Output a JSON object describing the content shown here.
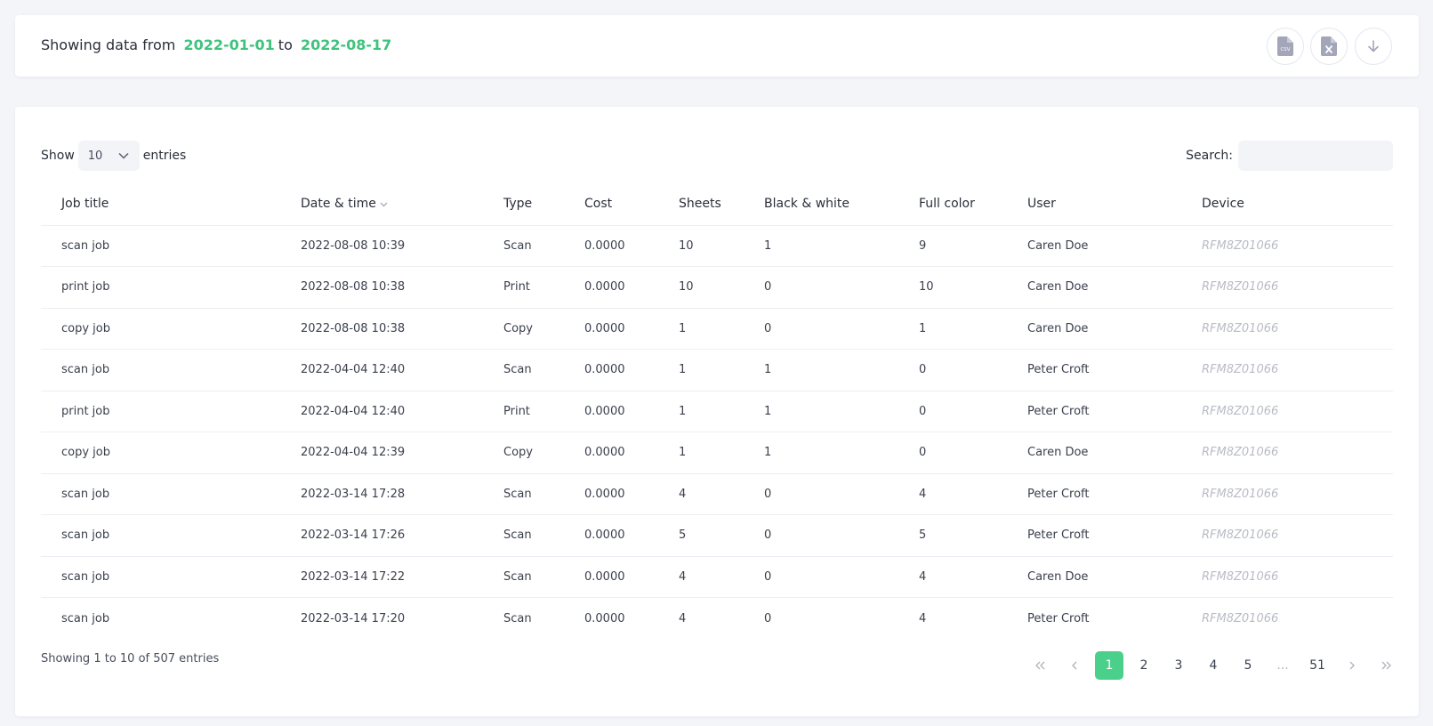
{
  "header": {
    "prefix": "Showing data from",
    "start_date": "2022-01-01",
    "connector": "to",
    "end_date": "2022-08-17",
    "actions": [
      {
        "icon": "csv-file-icon"
      },
      {
        "icon": "excel-file-icon"
      },
      {
        "icon": "download-icon"
      }
    ]
  },
  "controls": {
    "show_label": "Show",
    "page_size": "10",
    "entries_label": "entries",
    "search_label": "Search:",
    "search_placeholder": ""
  },
  "table": {
    "columns": [
      "Job title",
      "Date & time",
      "Type",
      "Cost",
      "Sheets",
      "Black & white",
      "Full color",
      "User",
      "Device"
    ],
    "sorted_column": "Date & time",
    "rows": [
      [
        "scan job",
        "2022-08-08 10:39",
        "Scan",
        "0.0000",
        "10",
        "1",
        "9",
        "Caren Doe",
        "RFM8Z01066"
      ],
      [
        "print job",
        "2022-08-08 10:38",
        "Print",
        "0.0000",
        "10",
        "0",
        "10",
        "Caren Doe",
        "RFM8Z01066"
      ],
      [
        "copy job",
        "2022-08-08 10:38",
        "Copy",
        "0.0000",
        "1",
        "0",
        "1",
        "Caren Doe",
        "RFM8Z01066"
      ],
      [
        "scan job",
        "2022-04-04 12:40",
        "Scan",
        "0.0000",
        "1",
        "1",
        "0",
        "Peter Croft",
        "RFM8Z01066"
      ],
      [
        "print job",
        "2022-04-04 12:40",
        "Print",
        "0.0000",
        "1",
        "1",
        "0",
        "Peter Croft",
        "RFM8Z01066"
      ],
      [
        "copy job",
        "2022-04-04 12:39",
        "Copy",
        "0.0000",
        "1",
        "1",
        "0",
        "Caren Doe",
        "RFM8Z01066"
      ],
      [
        "scan job",
        "2022-03-14 17:28",
        "Scan",
        "0.0000",
        "4",
        "0",
        "4",
        "Peter Croft",
        "RFM8Z01066"
      ],
      [
        "scan job",
        "2022-03-14 17:26",
        "Scan",
        "0.0000",
        "5",
        "0",
        "5",
        "Peter Croft",
        "RFM8Z01066"
      ],
      [
        "scan job",
        "2022-03-14 17:22",
        "Scan",
        "0.0000",
        "4",
        "0",
        "4",
        "Caren Doe",
        "RFM8Z01066"
      ],
      [
        "scan job",
        "2022-03-14 17:20",
        "Scan",
        "0.0000",
        "4",
        "0",
        "4",
        "Peter Croft",
        "RFM8Z01066"
      ]
    ]
  },
  "footer": {
    "summary": "Showing 1 to 10 of 507 entries",
    "pages": [
      "1",
      "2",
      "3",
      "4",
      "5",
      "...",
      "51"
    ],
    "current_page": "1"
  },
  "colors": {
    "accent": "#3fc37d",
    "active_page": "#4bd08b",
    "background": "#f3f5f9"
  }
}
